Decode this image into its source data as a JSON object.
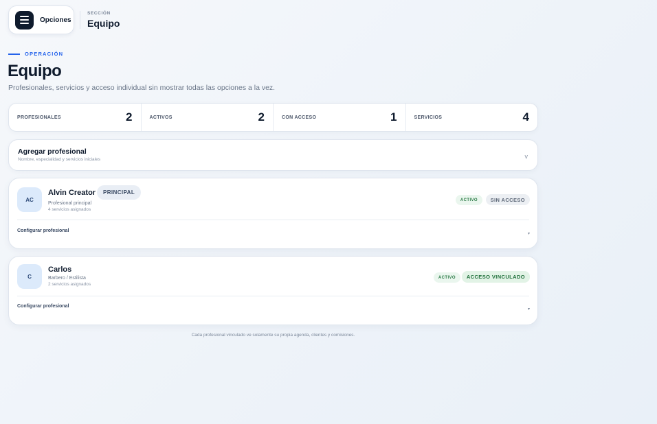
{
  "topbar": {
    "options_label": "Opciones",
    "section_key": "SECCIÓN",
    "section_value": "Equipo"
  },
  "heading": {
    "eyebrow": "OPERACIÓN",
    "title": "Equipo",
    "subtitle": "Profesionales, servicios y acceso individual sin mostrar todas las opciones a la vez."
  },
  "stats": [
    {
      "label": "PROFESIONALES",
      "value": "2"
    },
    {
      "label": "ACTIVOS",
      "value": "2"
    },
    {
      "label": "CON ACCESO",
      "value": "1"
    },
    {
      "label": "SERVICIOS",
      "value": "4"
    }
  ],
  "add_professional": {
    "title": "Agregar profesional",
    "subtitle": "Nombre, especialidad y servicios iniciales",
    "chevron": "v"
  },
  "professionals": [
    {
      "initials": "AC",
      "name": "Alvin Creator",
      "tag": "PRINCIPAL",
      "role": "Profesional principal",
      "services": "4 servicios asignados",
      "status": "ACTIVO",
      "access": "SIN ACCESO",
      "config_label": "Configurar profesional",
      "config_chevron": "▾"
    },
    {
      "initials": "C",
      "name": "Carlos",
      "role": "Barbero / Estilista",
      "services": "2 servicios asignados",
      "status": "ACTIVO",
      "access": "ACCESO VINCULADO",
      "config_label": "Configurar profesional",
      "config_chevron": "▾"
    }
  ],
  "footer_note": "Cada profesional vinculado ve solamente su propia agenda, clientes y comisiones."
}
